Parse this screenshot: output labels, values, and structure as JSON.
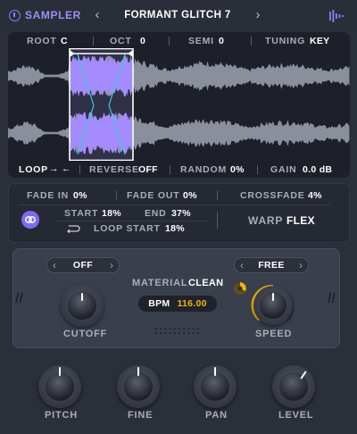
{
  "header": {
    "sampler_label": "SAMPLER",
    "preset_name": "FORMANT GLITCH 7",
    "prev_icon": "chevron-left-icon",
    "next_icon": "chevron-right-icon"
  },
  "wave_top": {
    "root_label": "ROOT",
    "root_value": "C",
    "oct_label": "OCT",
    "oct_value": "0",
    "semi_label": "SEMI",
    "semi_value": "0",
    "tuning_label": "TUNING",
    "tuning_value": "KEY"
  },
  "wave_bottom": {
    "loop_label": "LOOP",
    "loop_value": "→ ←",
    "reverse_label": "REVERSE",
    "reverse_value": "OFF",
    "random_label": "RANDOM",
    "random_value": "0%",
    "gain_label": "GAIN",
    "gain_value": "0.0 dB"
  },
  "mid": {
    "fade_in_label": "FADE IN",
    "fade_in_value": "0%",
    "fade_out_label": "FADE OUT",
    "fade_out_value": "0%",
    "crossfade_label": "CROSSFADE",
    "crossfade_value": "4%",
    "start_label": "START",
    "start_value": "18%",
    "end_label": "END",
    "end_value": "37%",
    "loop_start_label": "LOOP START",
    "loop_start_value": "18%",
    "warp_label": "WARP",
    "warp_value": "FLEX"
  },
  "main": {
    "left_select": "OFF",
    "right_select": "FREE",
    "material_label": "MATERIAL",
    "material_value": "CLEAN",
    "bpm_label": "BPM",
    "bpm_value": "116.00",
    "cutoff_label": "CUTOFF",
    "speed_label": "SPEED"
  },
  "knobs": {
    "pitch_label": "PITCH",
    "fine_label": "FINE",
    "pan_label": "PAN",
    "level_label": "LEVEL"
  },
  "colors": {
    "accent": "#8c7cf6",
    "selection": "#a48cff",
    "speed_ring": "#f2b705",
    "bpm_value": "#f2b705",
    "waveform": "#8a8f9c"
  }
}
